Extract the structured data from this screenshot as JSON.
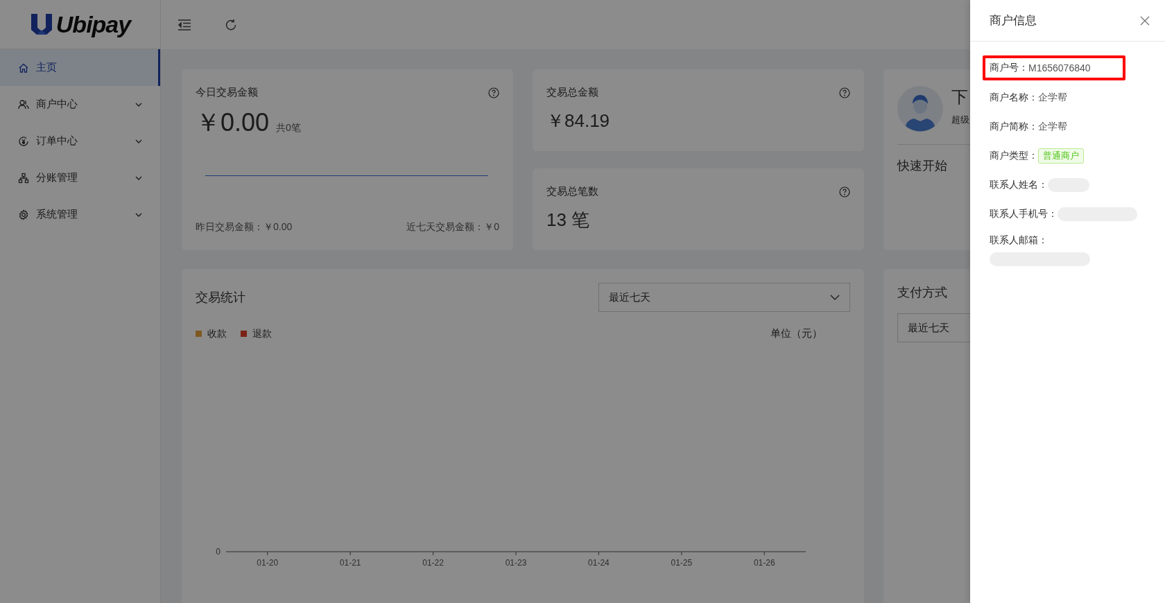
{
  "logo": {
    "text": "Ubipay"
  },
  "sidebar": {
    "items": [
      {
        "label": "主页",
        "selected": true,
        "expandable": false
      },
      {
        "label": "商户中心",
        "selected": false,
        "expandable": true,
        "expanded": false
      },
      {
        "label": "订单中心",
        "selected": false,
        "expandable": true,
        "expanded": false
      },
      {
        "label": "分账管理",
        "selected": false,
        "expandable": true,
        "expanded": false
      },
      {
        "label": "系统管理",
        "selected": false,
        "expandable": true,
        "expanded": false
      }
    ]
  },
  "today_card": {
    "title": "今日交易金额",
    "amount": "￥0.00",
    "count": "共0笔",
    "yesterday": "昨日交易金额：￥0.00",
    "week": "近七天交易金额：￥0"
  },
  "total_amount_card": {
    "title": "交易总金额",
    "value": "￥84.19"
  },
  "total_count_card": {
    "title": "交易总笔数",
    "value": "13 笔"
  },
  "user_card": {
    "greeting": "下",
    "role": "超级",
    "quick_start": "快速开始"
  },
  "stats_card": {
    "title": "交易统计",
    "range": "最近七天",
    "unit": "单位（元）",
    "legend": [
      {
        "label": "收款",
        "color": "#7e5921"
      },
      {
        "label": "退款",
        "color": "#7b2418"
      }
    ],
    "y_tick": "0",
    "x_labels": [
      "01-20",
      "01-21",
      "01-22",
      "01-23",
      "01-24",
      "01-25",
      "01-26"
    ]
  },
  "payment_card": {
    "title": "支付方式",
    "range": "最近七天"
  },
  "drawer": {
    "title": "商户信息",
    "fields": [
      {
        "label": "商户号：",
        "value": "M1656076840",
        "highlighted": true,
        "redacted": false
      },
      {
        "label": "商户名称：",
        "value": "企学帮",
        "highlighted": false,
        "redacted": false
      },
      {
        "label": "商户简称：",
        "value": "企学帮",
        "highlighted": false,
        "redacted": false
      },
      {
        "label": "商户类型：",
        "tag": "普通商户",
        "highlighted": false,
        "redacted": false
      },
      {
        "label": "联系人姓名：",
        "highlighted": false,
        "redacted": true
      },
      {
        "label": "联系人手机号：",
        "highlighted": false,
        "redacted": true
      },
      {
        "label": "联系人邮箱：",
        "highlighted": false,
        "redacted": true
      }
    ]
  }
}
